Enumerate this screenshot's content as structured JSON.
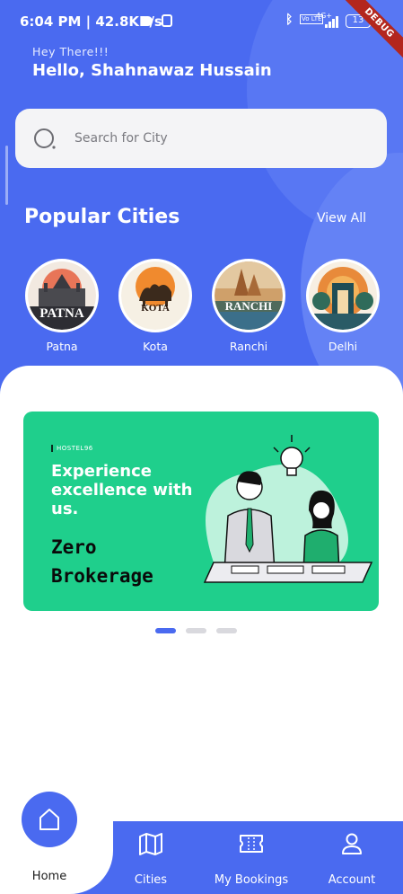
{
  "status_bar": {
    "time": "6:04 PM | 42.8KB/s",
    "battery": "13",
    "network": "4G+",
    "volte": "Vo LTE",
    "debug_label": "DEBUG"
  },
  "header": {
    "greeting": "Hey There!!!",
    "user_name": "Hello, Shahnawaz Hussain"
  },
  "search": {
    "placeholder": "Search for City",
    "value": ""
  },
  "popular": {
    "title": "Popular Cities",
    "view_all": "View All",
    "cities": [
      {
        "name": "Patna",
        "art_text": "PATNA",
        "icon": "patna-city-icon"
      },
      {
        "name": "Kota",
        "art_text": "KOTA",
        "icon": "kota-city-icon"
      },
      {
        "name": "Ranchi",
        "art_text": "RANCHI",
        "icon": "ranchi-city-icon"
      },
      {
        "name": "Delhi",
        "art_text": "",
        "icon": "delhi-city-icon"
      }
    ]
  },
  "banner": {
    "brand": "HOSTEL96",
    "headline": "Experience excellence with us.",
    "cta": "Zero Brokerage",
    "illustration": "two-people-with-lightbulb-illustration"
  },
  "carousel": {
    "active_index": 0,
    "count": 3
  },
  "bottom_nav": {
    "items": [
      {
        "label": "Home",
        "icon": "home-icon"
      },
      {
        "label": "Cities",
        "icon": "map-icon"
      },
      {
        "label": "My Bookings",
        "icon": "ticket-icon"
      },
      {
        "label": "Account",
        "icon": "user-icon"
      }
    ]
  },
  "colors": {
    "primary": "#4a6af0",
    "banner_green": "#1fcf8c",
    "search_bg": "#f4f4f6"
  }
}
